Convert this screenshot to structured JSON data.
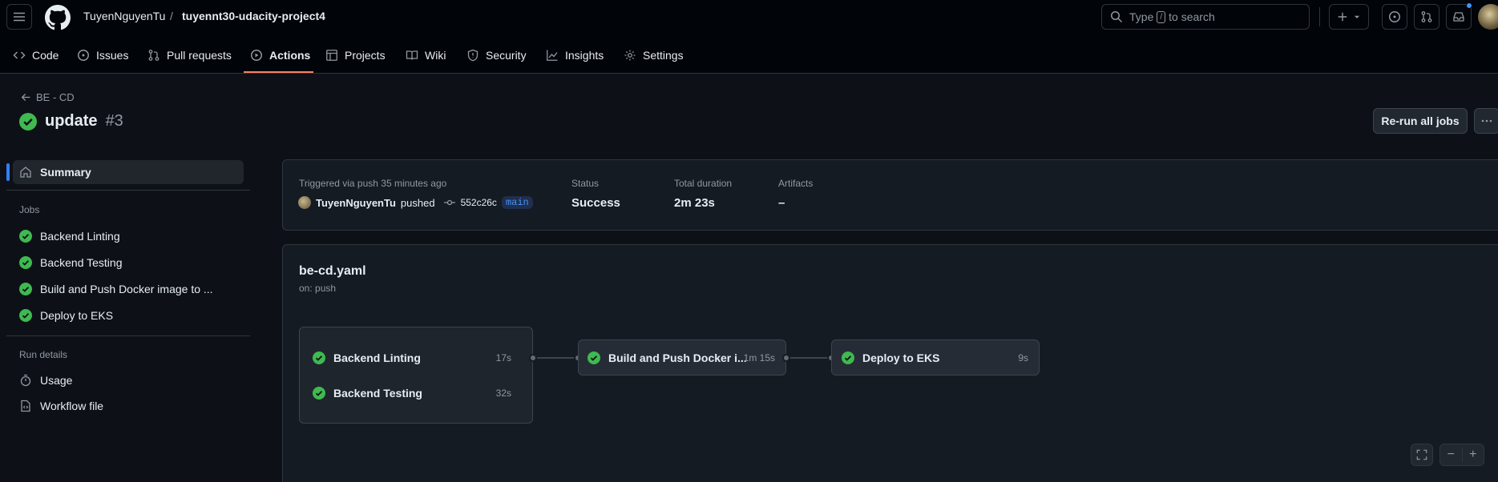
{
  "header": {
    "owner": "TuyenNguyenTu",
    "separator": "/",
    "repo": "tuyennt30-udacity-project4",
    "search_placeholder_pre": "Type",
    "search_key": "/",
    "search_placeholder_post": "to search"
  },
  "tabs": [
    {
      "label": "Code",
      "icon": "code-icon"
    },
    {
      "label": "Issues",
      "icon": "issue-icon"
    },
    {
      "label": "Pull requests",
      "icon": "pull-request-icon"
    },
    {
      "label": "Actions",
      "icon": "play-icon",
      "active": true
    },
    {
      "label": "Projects",
      "icon": "table-icon"
    },
    {
      "label": "Wiki",
      "icon": "book-icon"
    },
    {
      "label": "Security",
      "icon": "shield-icon"
    },
    {
      "label": "Insights",
      "icon": "graph-icon"
    },
    {
      "label": "Settings",
      "icon": "gear-icon"
    }
  ],
  "page": {
    "back_label": "BE - CD",
    "title": "update",
    "run_number": "#3",
    "rerun_label": "Re-run all jobs"
  },
  "sidebar": {
    "summary_label": "Summary",
    "jobs_heading": "Jobs",
    "jobs": [
      {
        "label": "Backend Linting"
      },
      {
        "label": "Backend Testing"
      },
      {
        "label": "Build and Push Docker image to ..."
      },
      {
        "label": "Deploy to EKS"
      }
    ],
    "run_details_heading": "Run details",
    "usage_label": "Usage",
    "workflow_file_label": "Workflow file"
  },
  "summary": {
    "triggered_label": "Triggered via push 35 minutes ago",
    "user": "TuyenNguyenTu",
    "action": "pushed",
    "commit": "552c26c",
    "branch": "main",
    "status_label": "Status",
    "status_value": "Success",
    "duration_label": "Total duration",
    "duration_value": "2m 23s",
    "artifacts_label": "Artifacts",
    "artifacts_value": "–"
  },
  "workflow": {
    "file": "be-cd.yaml",
    "trigger": "on: push",
    "jobs": {
      "lint": {
        "label": "Backend Linting",
        "duration": "17s"
      },
      "test": {
        "label": "Backend Testing",
        "duration": "32s"
      },
      "build": {
        "label": "Build and Push Docker i...",
        "duration": "1m 15s"
      },
      "deploy": {
        "label": "Deploy to EKS",
        "duration": "9s"
      }
    },
    "zoom_out": "−",
    "zoom_in": "+"
  },
  "colors": {
    "success": "#3fb950",
    "accent_underline": "#f78166",
    "link_blue": "#4493f8"
  }
}
